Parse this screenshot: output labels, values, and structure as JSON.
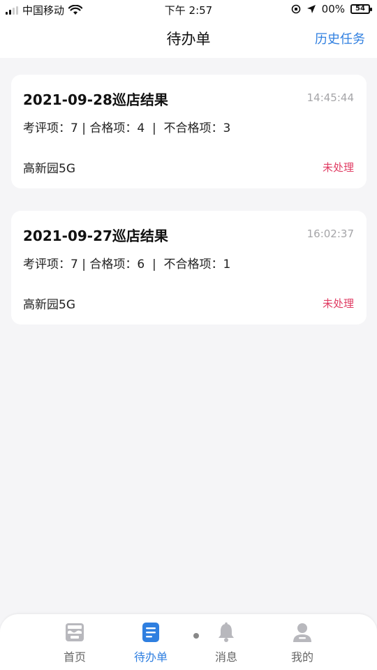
{
  "status_bar": {
    "carrier": "中国移动",
    "time": "下午 2:57",
    "battery_text": "00%",
    "battery_level": "54"
  },
  "nav": {
    "title": "待办单",
    "history_label": "历史任务"
  },
  "tasks": [
    {
      "title": "2021-09-28巡店结果",
      "time": "14:45:44",
      "stats": "考评项：7 | 合格项：4  |  不合格项：3",
      "store": "高新园5G",
      "status": "未处理"
    },
    {
      "title": "2021-09-27巡店结果",
      "time": "16:02:37",
      "stats": "考评项：7 | 合格项：6  |  不合格项：1",
      "store": "高新园5G",
      "status": "未处理"
    }
  ],
  "tabs": [
    {
      "label": "首页",
      "icon": "home-shop-icon"
    },
    {
      "label": "待办单",
      "icon": "document-icon"
    },
    {
      "label": "消息",
      "icon": "bell-icon"
    },
    {
      "label": "我的",
      "icon": "user-icon"
    }
  ],
  "colors": {
    "accent": "#2f7fe0",
    "pending": "#e03c63",
    "inactive_icon": "#b8b8bd"
  }
}
